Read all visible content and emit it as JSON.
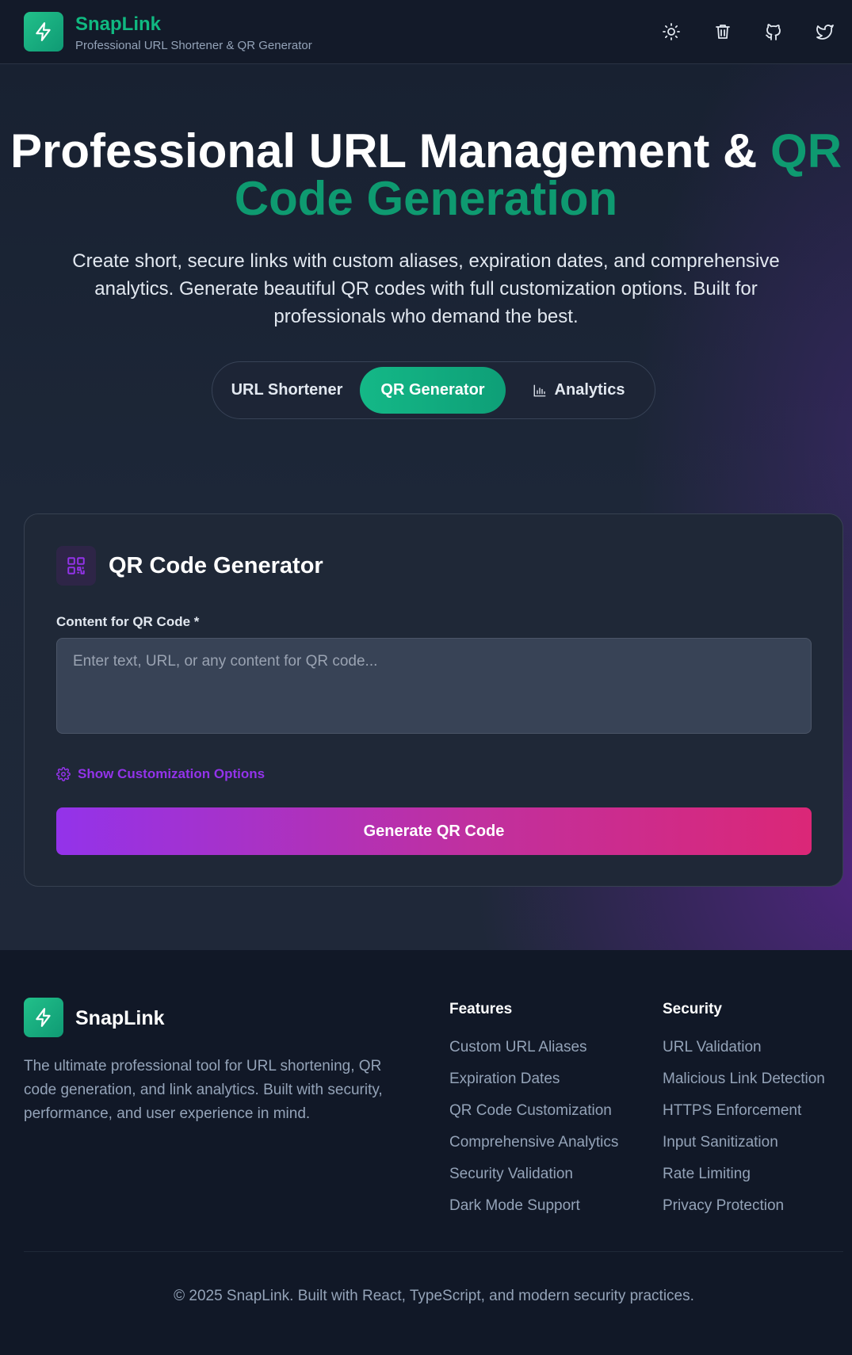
{
  "header": {
    "brand": "SnapLink",
    "tagline": "Professional URL Shortener & QR Generator",
    "icons": [
      "sun-icon",
      "trash-icon",
      "github-icon",
      "twitter-icon"
    ]
  },
  "hero": {
    "title_main": "Professional URL Management & ",
    "title_accent_1": "QR",
    "title_accent_2": "Code Generation",
    "subtitle": "Create short, secure links with custom aliases, expiration dates, and comprehensive analytics. Generate beautiful QR codes with full customization options. Built for professionals who demand the best."
  },
  "tabs": [
    {
      "label": "URL Shortener",
      "active": false
    },
    {
      "label": "QR Generator",
      "active": true
    },
    {
      "label": "Analytics",
      "active": false,
      "icon": "bar-chart-icon"
    }
  ],
  "qr_card": {
    "title": "QR Code Generator",
    "content_label": "Content for QR Code *",
    "content_value": "",
    "content_placeholder": "Enter text, URL, or any content for QR code...",
    "customize_label": "Show Customization Options",
    "generate_label": "Generate QR Code"
  },
  "footer": {
    "brand": "SnapLink",
    "description": "The ultimate professional tool for URL shortening, QR code generation, and link analytics. Built with security, performance, and user experience in mind.",
    "features_title": "Features",
    "features": [
      "Custom URL Aliases",
      "Expiration Dates",
      "QR Code Customization",
      "Comprehensive Analytics",
      "Security Validation",
      "Dark Mode Support"
    ],
    "security_title": "Security",
    "security": [
      "URL Validation",
      "Malicious Link Detection",
      "HTTPS Enforcement",
      "Input Sanitization",
      "Rate Limiting",
      "Privacy Protection"
    ],
    "copyright": "© 2025 SnapLink. Built with React, TypeScript, and modern security practices."
  },
  "colors": {
    "brand_green": "#10b981",
    "accent_purple": "#9333ea",
    "accent_pink": "#db2777",
    "background": "#111827"
  }
}
